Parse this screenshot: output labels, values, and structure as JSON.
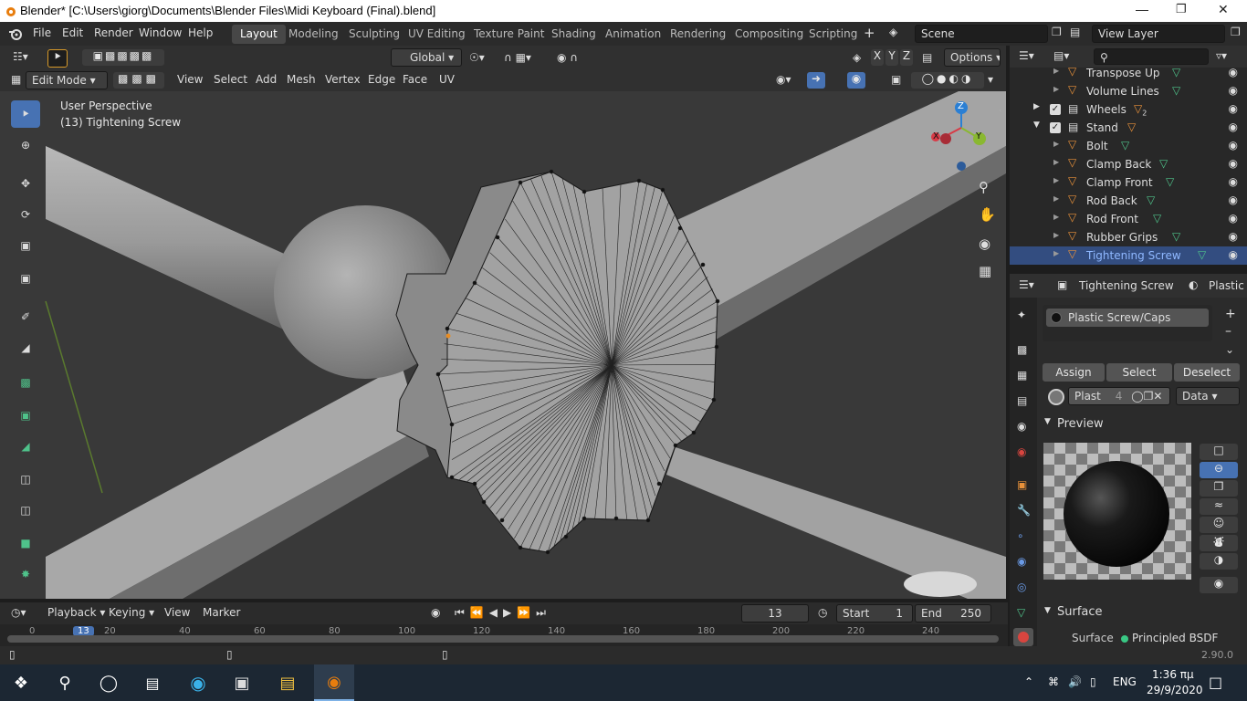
{
  "window": {
    "title": "Blender* [C:\\Users\\giorg\\Documents\\Blender Files\\Midi Keyboard (Final).blend]"
  },
  "menu": {
    "file": "File",
    "edit": "Edit",
    "render": "Render",
    "window": "Window",
    "help": "Help"
  },
  "workspaces": [
    "Layout",
    "Modeling",
    "Sculpting",
    "UV Editing",
    "Texture Paint",
    "Shading",
    "Animation",
    "Rendering",
    "Compositing",
    "Scripting"
  ],
  "scene": "Scene",
  "view_layer": "View Layer",
  "header": {
    "transform": "Global",
    "options": "Options",
    "x": "X",
    "y": "Y",
    "z": "Z"
  },
  "editbar": {
    "mode": "Edit Mode",
    "view": "View",
    "select": "Select",
    "add": "Add",
    "mesh": "Mesh",
    "vertex": "Vertex",
    "edge": "Edge",
    "face": "Face",
    "uv": "UV"
  },
  "viewport": {
    "perspective": "User Perspective",
    "object": "(13) Tightening Screw"
  },
  "gizmo": {
    "x": "X",
    "y": "Y",
    "z": "Z"
  },
  "outliner": {
    "rows": [
      {
        "name": "Transpose Up",
        "indent": 2
      },
      {
        "name": "Volume Lines",
        "indent": 2
      },
      {
        "name": "Wheels",
        "indent": 1,
        "badge": "2"
      },
      {
        "name": "Stand",
        "indent": 1
      },
      {
        "name": "Bolt",
        "indent": 2
      },
      {
        "name": "Clamp Back",
        "indent": 2
      },
      {
        "name": "Clamp Front",
        "indent": 2
      },
      {
        "name": "Rod Back",
        "indent": 2
      },
      {
        "name": "Rod Front",
        "indent": 2
      },
      {
        "name": "Rubber Grips",
        "indent": 2
      },
      {
        "name": "Tightening Screw",
        "indent": 2,
        "selected": true
      }
    ]
  },
  "properties": {
    "object": "Tightening Screw",
    "material_crumb": "Plastic S",
    "slot": "Plastic Screw/Caps",
    "assign": "Assign",
    "select": "Select",
    "deselect": "Deselect",
    "mat_name": "Plast",
    "users": "4",
    "data": "Data",
    "preview": "Preview",
    "surface_panel": "Surface",
    "surface_label": "Surface",
    "surface_value": "Principled BSDF"
  },
  "timeline": {
    "playback": "Playback",
    "keying": "Keying",
    "view": "View",
    "marker": "Marker",
    "frame": "13",
    "start_label": "Start",
    "start": "1",
    "end_label": "End",
    "end": "250",
    "ruler": [
      "0",
      "13",
      "20",
      "40",
      "60",
      "80",
      "100",
      "120",
      "140",
      "160",
      "180",
      "200",
      "220",
      "240"
    ]
  },
  "status": {
    "version": "2.90.0"
  },
  "taskbar": {
    "lang": "ENG",
    "time": "1:36 πμ",
    "date": "29/9/2020"
  }
}
